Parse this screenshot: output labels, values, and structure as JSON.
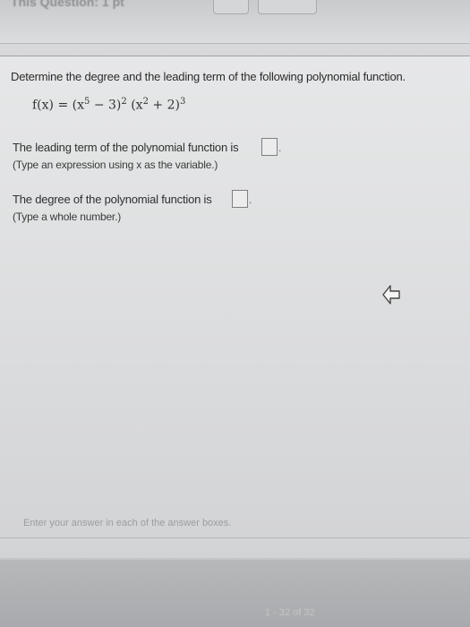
{
  "header": {
    "title": "This Question: 1 pt"
  },
  "question": {
    "prompt": "Determine the degree and the leading term of the following polynomial function.",
    "function_lhs": "f(x) = ",
    "function_terms": [
      {
        "base": "(x",
        "inner_exp": "5",
        "rest": " − 3)",
        "outer_exp": "2"
      },
      {
        "base": "(x",
        "inner_exp": "2",
        "rest": " + 2)",
        "outer_exp": "3"
      }
    ]
  },
  "part1": {
    "text": "The leading term of the polynomial function is",
    "hint": "(Type an expression using x as the variable.)"
  },
  "part2": {
    "text": "The degree of the polynomial function is",
    "hint": "(Type a whole number.)"
  },
  "footer": {
    "instruction": "Enter your answer in each of the answer boxes.",
    "page_count": "1 - 32 of 32"
  }
}
